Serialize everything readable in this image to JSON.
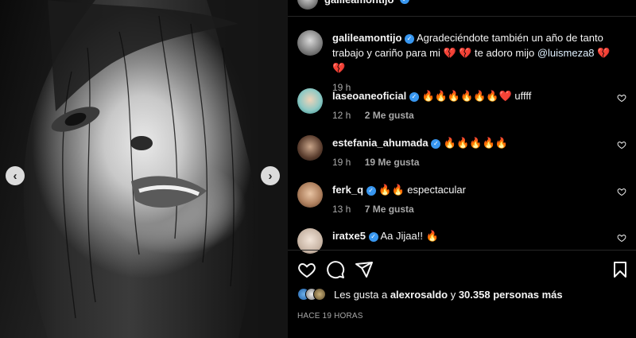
{
  "post": {
    "author": "galileamontijo",
    "caption_text": "Agradeciéndote también un año de tanto trabajo y cariño para mi 💔 💔  te adoro mijo ",
    "caption_mention": "@luismeza8",
    "caption_tail": " 💔 💔",
    "caption_time": "19 h"
  },
  "comments": [
    {
      "user": "laseoaneoficial",
      "text": "🔥🔥🔥🔥🔥🔥❤️ uffff",
      "time": "12 h",
      "likes": "2 Me gusta"
    },
    {
      "user": "estefania_ahumada",
      "text": "🔥🔥🔥🔥🔥",
      "time": "19 h",
      "likes": "19 Me gusta"
    },
    {
      "user": "ferk_q",
      "text": "🔥🔥 espectacular",
      "time": "13 h",
      "likes": "7 Me gusta"
    },
    {
      "user": "iratxe5",
      "text": "Aa Jijaa!! 🔥",
      "time": "",
      "likes": ""
    }
  ],
  "carousel": {
    "prev_icon": "‹",
    "next_icon": "›"
  },
  "likes": {
    "prefix": "Les gusta a ",
    "first_user": "alexrosaldo",
    "middle": " y ",
    "others": "30.358 personas más"
  },
  "time_ago": "HACE 19 HORAS",
  "colors": {
    "background": "#000000",
    "text": "#f5f5f5",
    "muted": "#a8a8a8",
    "verified": "#3897f0",
    "mention": "#e0f1ff"
  }
}
